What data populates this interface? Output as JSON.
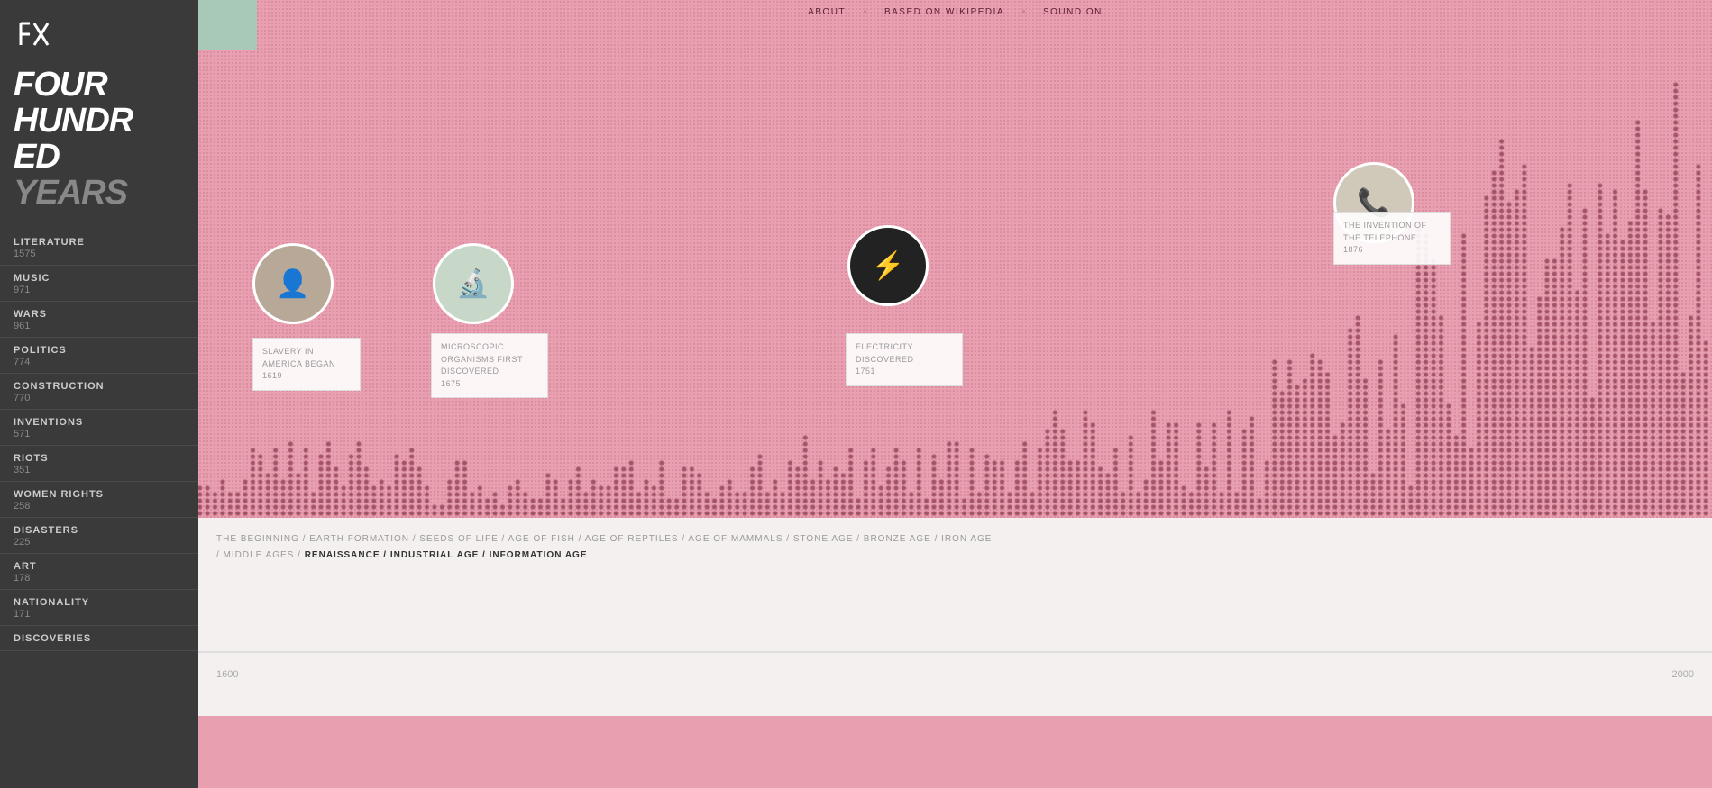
{
  "sidebar": {
    "title_main": "FOUR HUNDR ED",
    "title_years": "YEARS",
    "nav_items": [
      {
        "label": "LITERATURE",
        "count": "1575"
      },
      {
        "label": "MUSIC",
        "count": "971"
      },
      {
        "label": "WARS",
        "count": "961"
      },
      {
        "label": "POLITICS",
        "count": "774"
      },
      {
        "label": "CONSTRUCTION",
        "count": "770"
      },
      {
        "label": "INVENTIONS",
        "count": "571"
      },
      {
        "label": "RIOTS",
        "count": "351"
      },
      {
        "label": "WOMEN RIGHTS",
        "count": "258"
      },
      {
        "label": "DISASTERS",
        "count": "225"
      },
      {
        "label": "ART",
        "count": "178"
      },
      {
        "label": "NATIONALITY",
        "count": "171"
      },
      {
        "label": "DISCOVERIES",
        "count": ""
      }
    ]
  },
  "top_nav": {
    "about": "ABOUT",
    "dot1": "◦",
    "based_on": "BASED ON WIKIPEDIA",
    "dot2": "◦",
    "sound": "SOUND ON"
  },
  "callouts": {
    "slavery": {
      "title": "SLAVERY IN AMERICA BEGAN",
      "year": "1619"
    },
    "microscopic": {
      "title": "MICROSCOPIC ORGANISMS FIRST DISCOVERED",
      "year": "1675"
    },
    "electricity": {
      "title": "ELECTRICITY DISCOVERED",
      "year": "1751"
    },
    "telephone": {
      "title": "THE INVENTION OF THE TELEPHONE",
      "year": "1876"
    }
  },
  "eras": {
    "line1": "THE BEGINNING / EARTH FORMATION / SEEDS OF LIFE / AGE OF FISH / AGE OF REPTILES / AGE OF MAMMALS / STONE AGE / BRONZE AGE / IRON AGE",
    "line2_pre": "/ MIDDLE AGES /",
    "line2_bold": "RENAISSANCE / INDUSTRIAL AGE / INFORMATION AGE",
    "year1": "1600",
    "year2": "2000"
  }
}
